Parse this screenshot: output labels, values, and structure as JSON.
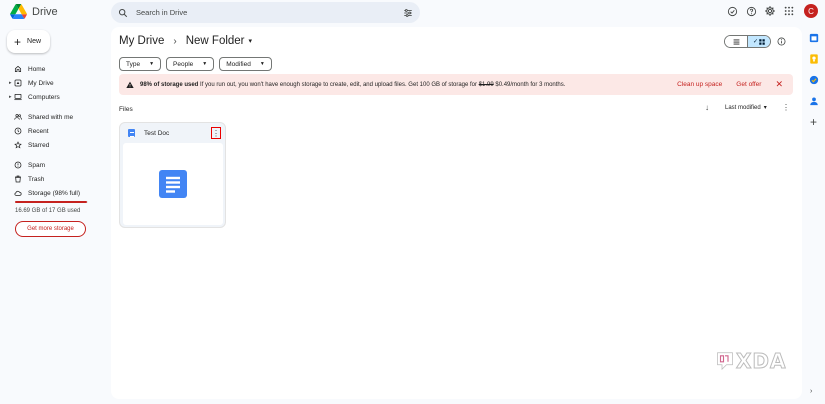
{
  "app": {
    "title": "Drive"
  },
  "search": {
    "placeholder": "Search in Drive"
  },
  "account": {
    "initial": "C"
  },
  "new_button": {
    "label": "New"
  },
  "sidebar": {
    "items": [
      {
        "label": "Home",
        "icon": "home-icon"
      },
      {
        "label": "My Drive",
        "icon": "my-drive-icon",
        "expandable": true
      },
      {
        "label": "Computers",
        "icon": "computers-icon",
        "expandable": true
      },
      {
        "label": "Shared with me",
        "icon": "shared-icon"
      },
      {
        "label": "Recent",
        "icon": "clock-icon"
      },
      {
        "label": "Starred",
        "icon": "star-icon"
      },
      {
        "label": "Spam",
        "icon": "spam-icon"
      },
      {
        "label": "Trash",
        "icon": "trash-icon"
      },
      {
        "label": "Storage (98% full)",
        "icon": "cloud-icon"
      }
    ]
  },
  "storage": {
    "used_fraction": 0.98,
    "used_text": "16.69 GB of 17 GB used",
    "get_more_label": "Get more storage"
  },
  "breadcrumb": {
    "root": "My Drive",
    "separator": "›",
    "current": "New Folder"
  },
  "filters": [
    {
      "label": "Type"
    },
    {
      "label": "People"
    },
    {
      "label": "Modified"
    }
  ],
  "banner": {
    "bold": "98% of storage used",
    "text": " If you run out, you won't have enough storage to create, edit, and upload files. Get 100 GB of storage for ",
    "old_price": "$1.99",
    "new_price": " $0.49/month for 3 months.",
    "action_clean": "Clean up space",
    "action_offer": "Get offer",
    "close": "✕"
  },
  "files": {
    "section_label": "Files",
    "sort_label": "Last modified",
    "items": [
      {
        "name": "Test Doc"
      }
    ]
  },
  "watermark": {
    "text": "XDA"
  },
  "colors": {
    "accent_blue": "#4285f4",
    "warning_red": "#c5221f",
    "banner_bg": "#fce8e6",
    "selected_view": "#c2e7ff",
    "highlight_border": "#ea0000"
  }
}
